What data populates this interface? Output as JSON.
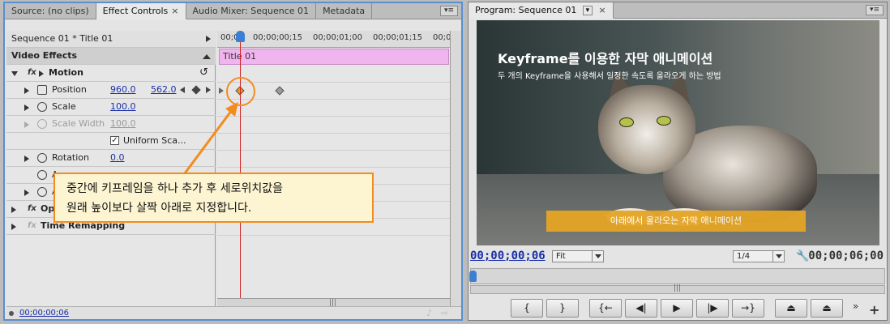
{
  "left_panel": {
    "tabs": [
      {
        "label": "Source: (no clips)"
      },
      {
        "label": "Effect Controls",
        "close": "×"
      },
      {
        "label": "Audio Mixer: Sequence 01"
      },
      {
        "label": "Metadata"
      }
    ],
    "menu_glyph": "▾≡",
    "sequence_label": "Sequence 01 * Title 01",
    "section_title": "Video Effects",
    "motion_label": "Motion",
    "reset_glyph": "↺",
    "properties": {
      "position": {
        "label": "Position",
        "x": "960.0",
        "y": "562.0"
      },
      "scale": {
        "label": "Scale",
        "value": "100.0"
      },
      "scale_width": {
        "label": "Scale Width",
        "value": "100.0"
      },
      "uniform_scale": {
        "label": "Uniform Sca...",
        "checked": "✓"
      },
      "rotation": {
        "label": "Rotation",
        "value": "0.0"
      },
      "anchor_partial": "A",
      "anti_partial": "A"
    },
    "opacity_partial": "Opa",
    "time_remapping": "Time Remapping",
    "timeline": {
      "ticks": [
        "00;00",
        "00;00;00;15",
        "00;00;01;00",
        "00;00;01;15",
        "00;0"
      ],
      "clip_label": "Title 01"
    },
    "current_time": "00;00;00;06",
    "scroll_grip": "|||"
  },
  "callout": {
    "line1": "중간에 키프레임을 하나 추가 후 세로위치값을",
    "line2": "원래 높이보다 살짝 아래로 지정합니다."
  },
  "right_panel": {
    "tab_label": "Program: Sequence 01",
    "tab_dropdown": "▾",
    "tab_close": "×",
    "menu_glyph": "▾≡",
    "video": {
      "title": "Keyframe를 이용한 자막 애니메이션",
      "subtitle": "두 개의 Keyframe을 사용해서 일정한 속도록 올라오게 하는 방법",
      "bar_text": "아래에서 올라오는 자막 애니메이션"
    },
    "current_timecode": "00;00;00;06",
    "zoom_select": "Fit",
    "quality_select": "1/4",
    "duration_timecode": "00;00;06;00",
    "buttons": [
      {
        "name": "mark-in-button",
        "glyph": "{"
      },
      {
        "name": "mark-out-button",
        "glyph": "}"
      },
      {
        "name": "go-to-in-button",
        "glyph": "{←"
      },
      {
        "name": "step-back-button",
        "glyph": "◀|"
      },
      {
        "name": "play-button",
        "glyph": "▶"
      },
      {
        "name": "step-forward-button",
        "glyph": "|▶"
      },
      {
        "name": "go-to-out-button",
        "glyph": "→}"
      },
      {
        "name": "lift-button",
        "glyph": "⏏"
      },
      {
        "name": "extract-button",
        "glyph": "⏏"
      }
    ],
    "more_glyph": "»",
    "add_glyph": "+"
  },
  "colors": {
    "clip_bar": "#f0b4ee",
    "playhead": "#d21e1e",
    "callout_border": "#f28c1e",
    "link_blue": "#1a2ea8",
    "title_bar": "#e5a526"
  }
}
